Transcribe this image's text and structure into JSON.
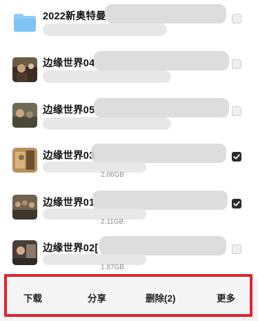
{
  "files": [
    {
      "title": "2022新奥特曼",
      "size": "",
      "selected": false,
      "thumb": "folder-icon"
    },
    {
      "title": "边缘世界04",
      "size": "",
      "selected": false,
      "thumb": "video-thumbnail"
    },
    {
      "title": "边缘世界05",
      "size": "",
      "selected": false,
      "thumb": "video-thumbnail"
    },
    {
      "title": "边缘世界03",
      "size": "2.06GB",
      "selected": true,
      "thumb": "video-thumbnail"
    },
    {
      "title": "边缘世界01",
      "size": "2.11GB",
      "selected": true,
      "thumb": "video-thumbnail"
    },
    {
      "title": "边缘世界02[",
      "size": "1.87GB",
      "selected": false,
      "thumb": "video-thumbnail"
    }
  ],
  "toolbar": {
    "download": "下载",
    "share": "分享",
    "delete": "删除(2)",
    "more": "更多"
  },
  "colors": {
    "highlight_border": "#e0242e",
    "checkbox_checked": "#2b2b2b",
    "folder": "#7fc4f5"
  }
}
